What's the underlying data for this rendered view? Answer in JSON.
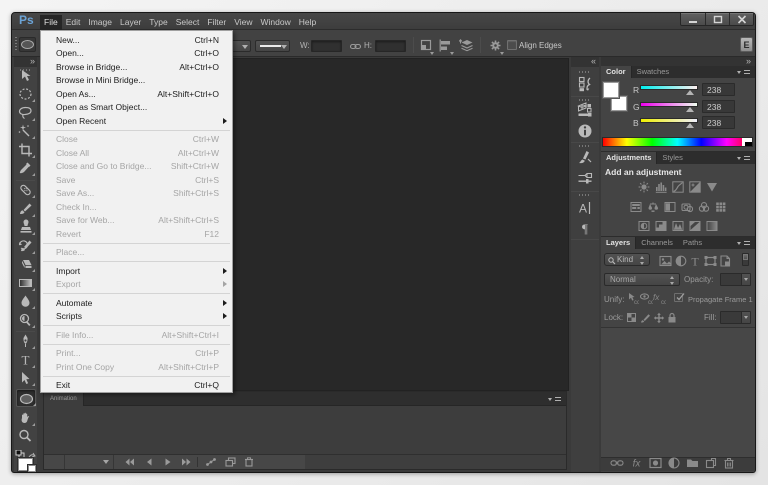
{
  "colors": {
    "ps_logo_blue": "#6ba3d6",
    "menu_highlight_bg": "#262626",
    "canvas_bg": "#282828",
    "panel_bg": "#444444",
    "menu_popup_bg": "#f1f1f1",
    "rgb_value": "238"
  },
  "titlebar": {
    "logo": "Ps",
    "menus": [
      {
        "label": "File",
        "open": true
      },
      {
        "label": "Edit"
      },
      {
        "label": "Image"
      },
      {
        "label": "Layer"
      },
      {
        "label": "Type"
      },
      {
        "label": "Select"
      },
      {
        "label": "Filter"
      },
      {
        "label": "View"
      },
      {
        "label": "Window"
      },
      {
        "label": "Help"
      }
    ],
    "window_buttons": [
      "minimize",
      "maximize",
      "close"
    ]
  },
  "file_menu": {
    "items": [
      {
        "label": "New...",
        "shortcut": "Ctrl+N",
        "enabled": true
      },
      {
        "label": "Open...",
        "shortcut": "Ctrl+O",
        "enabled": true
      },
      {
        "label": "Browse in Bridge...",
        "shortcut": "Alt+Ctrl+O",
        "enabled": true
      },
      {
        "label": "Browse in Mini Bridge...",
        "shortcut": "",
        "enabled": true
      },
      {
        "label": "Open As...",
        "shortcut": "Alt+Shift+Ctrl+O",
        "enabled": true
      },
      {
        "label": "Open as Smart Object...",
        "shortcut": "",
        "enabled": true
      },
      {
        "label": "Open Recent",
        "shortcut": "",
        "enabled": true,
        "submenu": true
      },
      {
        "separator": true
      },
      {
        "label": "Close",
        "shortcut": "Ctrl+W",
        "enabled": false
      },
      {
        "label": "Close All",
        "shortcut": "Alt+Ctrl+W",
        "enabled": false
      },
      {
        "label": "Close and Go to Bridge...",
        "shortcut": "Shift+Ctrl+W",
        "enabled": false
      },
      {
        "label": "Save",
        "shortcut": "Ctrl+S",
        "enabled": false
      },
      {
        "label": "Save As...",
        "shortcut": "Shift+Ctrl+S",
        "enabled": false
      },
      {
        "label": "Check In...",
        "shortcut": "",
        "enabled": false
      },
      {
        "label": "Save for Web...",
        "shortcut": "Alt+Shift+Ctrl+S",
        "enabled": false
      },
      {
        "label": "Revert",
        "shortcut": "F12",
        "enabled": false
      },
      {
        "separator": true
      },
      {
        "label": "Place...",
        "shortcut": "",
        "enabled": false
      },
      {
        "separator": true
      },
      {
        "label": "Import",
        "shortcut": "",
        "enabled": true,
        "submenu": true
      },
      {
        "label": "Export",
        "shortcut": "",
        "enabled": false,
        "submenu": true
      },
      {
        "separator": true
      },
      {
        "label": "Automate",
        "shortcut": "",
        "enabled": true,
        "submenu": true
      },
      {
        "label": "Scripts",
        "shortcut": "",
        "enabled": true,
        "submenu": true
      },
      {
        "separator": true
      },
      {
        "label": "File Info...",
        "shortcut": "Alt+Shift+Ctrl+I",
        "enabled": false
      },
      {
        "separator": true
      },
      {
        "label": "Print...",
        "shortcut": "Ctrl+P",
        "enabled": false
      },
      {
        "label": "Print One Copy",
        "shortcut": "Alt+Shift+Ctrl+P",
        "enabled": false
      },
      {
        "separator": true
      },
      {
        "label": "Exit",
        "shortcut": "Ctrl+Q",
        "enabled": true
      }
    ]
  },
  "options_bar": {
    "tool_preset_icon": "ellipse-tool-icon",
    "width_label": "W:",
    "width_value": "",
    "height_label": "H:",
    "height_value": "",
    "align_edges_label": "Align Edges",
    "align_edges_checked": false,
    "workspace_button": "E",
    "icons": [
      "link-dimensions-icon",
      "path-operations-icon",
      "align-icon",
      "arrange-icon",
      "gear-icon"
    ]
  },
  "toolbar": {
    "collapse_icon_glyph": "»",
    "tools": [
      {
        "name": "move-tool",
        "flyout": false
      },
      {
        "name": "elliptical-marquee-tool",
        "flyout": true
      },
      {
        "name": "lasso-tool",
        "flyout": true
      },
      {
        "name": "magic-wand-tool",
        "flyout": true
      },
      {
        "name": "crop-tool",
        "flyout": true
      },
      {
        "name": "eyedropper-tool",
        "flyout": true
      },
      {
        "name": "healing-brush-tool",
        "flyout": true
      },
      {
        "name": "brush-tool",
        "flyout": true
      },
      {
        "name": "clone-stamp-tool",
        "flyout": true
      },
      {
        "name": "history-brush-tool",
        "flyout": true
      },
      {
        "name": "eraser-tool",
        "flyout": true
      },
      {
        "name": "gradient-tool",
        "flyout": true
      },
      {
        "name": "blur-tool",
        "flyout": true
      },
      {
        "name": "dodge-tool",
        "flyout": true
      },
      {
        "name": "pen-tool",
        "flyout": true
      },
      {
        "name": "type-tool",
        "flyout": true
      },
      {
        "name": "path-selection-tool",
        "flyout": true
      },
      {
        "name": "ellipse-tool",
        "flyout": true,
        "selected": true
      },
      {
        "name": "hand-tool",
        "flyout": true
      },
      {
        "name": "zoom-tool",
        "flyout": false
      }
    ]
  },
  "dock_strip": {
    "collapse_left_glyph": "«",
    "collapse_right_glyph": "»",
    "groups": [
      [
        "history-panel-icon"
      ],
      [
        "3d-panel-icon",
        "info-panel-icon"
      ],
      [
        "brush-panel-icon",
        "brush-presets-panel-icon"
      ],
      [
        "character-panel-icon",
        "paragraph-panel-icon"
      ]
    ]
  },
  "panels": {
    "color": {
      "tabs": [
        "Color",
        "Swatches"
      ],
      "active_tab": "Color",
      "sliders": [
        {
          "channel": "R",
          "value": "238"
        },
        {
          "channel": "G",
          "value": "238"
        },
        {
          "channel": "B",
          "value": "238"
        }
      ]
    },
    "adjustments": {
      "tabs": [
        "Adjustments",
        "Styles"
      ],
      "active_tab": "Adjustments",
      "heading": "Add an adjustment",
      "icon_rows": [
        [
          "brightness-contrast-icon",
          "levels-icon",
          "curves-icon",
          "exposure-icon",
          "vibrance-icon"
        ],
        [
          "hue-saturation-icon",
          "color-balance-icon",
          "black-white-icon",
          "photo-filter-icon",
          "channel-mixer-icon",
          "color-lookup-icon"
        ],
        [
          "invert-icon",
          "posterize-icon",
          "threshold-icon",
          "gradient-map-icon",
          "selective-color-icon"
        ]
      ]
    },
    "layers": {
      "tabs": [
        "Layers",
        "Channels",
        "Paths"
      ],
      "active_tab": "Layers",
      "filter_label": "Kind",
      "filter_icons": [
        "pixel-layer-filter-icon",
        "adjustment-layer-filter-icon",
        "type-layer-filter-icon",
        "shape-layer-filter-icon",
        "smart-object-filter-icon"
      ],
      "blend_mode": "Normal",
      "opacity_label": "Opacity:",
      "unify_label": "Unify:",
      "unify_icons": [
        "unify-position-icon",
        "unify-visibility-icon",
        "unify-style-icon"
      ],
      "propagate_label": "Propagate Frame 1",
      "propagate_checked": true,
      "lock_label": "Lock:",
      "lock_icons": [
        "lock-transparent-icon",
        "lock-paint-icon",
        "lock-move-icon",
        "lock-all-icon"
      ],
      "fill_label": "Fill:",
      "bottom_icons": [
        "link-layers-icon",
        "layer-style-icon",
        "layer-mask-icon",
        "adjustment-layer-icon",
        "layer-group-icon",
        "new-layer-icon",
        "delete-layer-icon"
      ]
    }
  },
  "timeline": {
    "tab": "Animation",
    "controls": [
      "loop-selector",
      "first-frame-icon",
      "previous-frame-icon",
      "play-icon",
      "next-frame-icon",
      "tween-icon",
      "duplicate-frame-icon",
      "delete-frame-icon"
    ]
  }
}
